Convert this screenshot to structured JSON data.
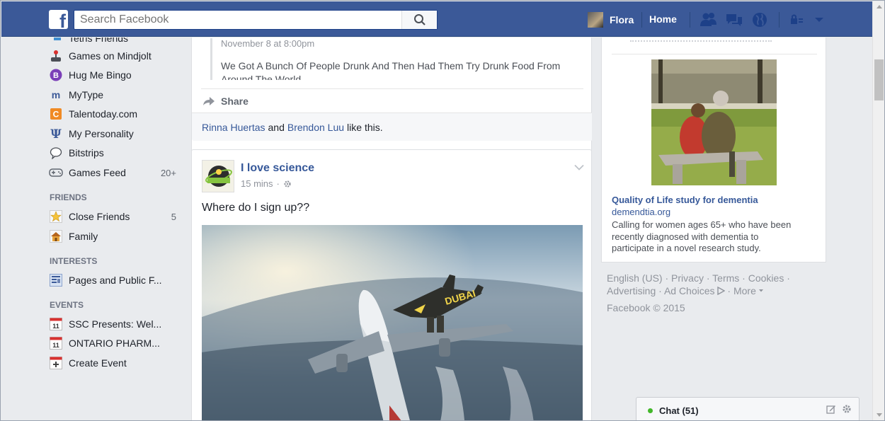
{
  "topbar": {
    "logo": "f",
    "search_placeholder": "Search Facebook",
    "profile_name": "Flora",
    "home_label": "Home",
    "color": "#3b5998"
  },
  "left_nav": {
    "items_top": [
      {
        "label": "Tetris Friends",
        "icon": "tetris-icon"
      },
      {
        "label": "Games on Mindjolt",
        "icon": "joystick-icon"
      },
      {
        "label": "Hug Me Bingo",
        "icon": "bingo-icon"
      },
      {
        "label": "MyType",
        "icon": "mytype-icon"
      },
      {
        "label": "Talentoday.com",
        "icon": "talentoday-icon"
      },
      {
        "label": "My Personality",
        "icon": "psi-icon"
      },
      {
        "label": "Bitstrips",
        "icon": "speech-bubble-icon"
      },
      {
        "label": "Games Feed",
        "icon": "gamepad-icon",
        "count": "20+"
      }
    ],
    "friends_heading": "FRIENDS",
    "friends": [
      {
        "label": "Close Friends",
        "icon": "star-icon",
        "count": "5"
      },
      {
        "label": "Family",
        "icon": "house-icon"
      }
    ],
    "interests_heading": "INTERESTS",
    "interests": [
      {
        "label": "Pages and Public F...",
        "icon": "feed-icon"
      }
    ],
    "events_heading": "EVENTS",
    "events": [
      {
        "label": "SSC Presents: Wel...",
        "icon": "calendar-icon",
        "day": "11"
      },
      {
        "label": "ONTARIO PHARM...",
        "icon": "calendar-icon",
        "day": "11"
      },
      {
        "label": "Create Event",
        "icon": "plus-calendar-icon"
      }
    ]
  },
  "feed": {
    "shared_post": {
      "time": "November 8 at 8:00pm",
      "quote_text": "We Got A Bunch Of People Drunk And Then Had Them Try Drunk Food From Around The World",
      "share_label": "Share",
      "liker1": "Rinna Huertas",
      "liker_and": "and",
      "liker2": "Brendon Luu",
      "likes_suffix": "like this."
    },
    "post": {
      "page_name": "I love science",
      "time": "15 mins",
      "text": "Where do I sign up??",
      "image_text": "DUBAI"
    }
  },
  "right_col": {
    "ad": {
      "title": "Quality of Life study for dementia",
      "domain": "demendtia.org",
      "body": "Calling for women ages 65+ who have been recently diagnosed with dementia to participate in a novel research study."
    },
    "footer_links": [
      "English (US)",
      "Privacy",
      "Terms",
      "Cookies",
      "Advertising",
      "Ad Choices",
      "More"
    ],
    "copyright": "Facebook © 2015"
  },
  "chat": {
    "label": "Chat (51)",
    "online_color": "#42b72a"
  }
}
